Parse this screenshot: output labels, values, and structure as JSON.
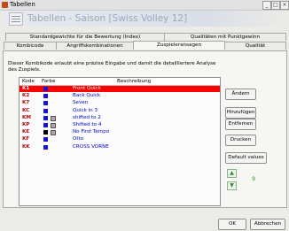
{
  "window": {
    "title": "Tabellen",
    "minimize": "_",
    "maximize": "□",
    "close": "×"
  },
  "banner": {
    "title": "Tabellen - Saison [Swiss Volley 12]"
  },
  "tabs": [
    {
      "label": "Standardgewichte für die Bewertung (Index)"
    },
    {
      "label": "Qualitäten mit Punktgewinn"
    },
    {
      "label": "Kombicode"
    },
    {
      "label": "Angriffskombinationen"
    },
    {
      "label": "Zuspieleransagen"
    },
    {
      "label": "Qualität"
    }
  ],
  "description": "Dieser Kombikode erlaubt eine präzise Eingabe und damit die detailliertere Analyse des Zuspiels.",
  "table": {
    "headers": {
      "code": "Kode",
      "color": "Farbe",
      "desc": "Beschreibung"
    },
    "rows": [
      {
        "code": "K1",
        "desc": "Front Quick",
        "color1": "#1515d6",
        "color2": ""
      },
      {
        "code": "K2",
        "desc": "Back Quick",
        "color1": "#1515d6",
        "color2": ""
      },
      {
        "code": "K7",
        "desc": "Seven",
        "color1": "#1515d6",
        "color2": ""
      },
      {
        "code": "KC",
        "desc": "Quick in 3",
        "color1": "#1515d6",
        "color2": ""
      },
      {
        "code": "KM",
        "desc": "shifted to 2",
        "color1": "#1515d6",
        "color2": "#b8a4a4"
      },
      {
        "code": "KP",
        "desc": "Shifted to 4",
        "color1": "#1515d6",
        "color2": "#b8a4a4"
      },
      {
        "code": "KE",
        "desc": "No First Tempo",
        "color1": "#000000",
        "color2": "#b8a4a4"
      },
      {
        "code": "KF",
        "desc": "Otto",
        "color1": "#1515d6",
        "color2": ""
      },
      {
        "code": "KK",
        "desc": "CROSS VORNE",
        "color1": "#1515d6",
        "color2": ""
      }
    ]
  },
  "buttons": {
    "change": "Ändern",
    "add": "Hinzufügen",
    "remove": "Entfernen",
    "print": "Drucken",
    "defaults": "Default values",
    "ok": "OK",
    "cancel": "Abbrechen"
  },
  "move": {
    "up": "▲",
    "down": "▼",
    "count": "9"
  },
  "colors": {
    "selected_row": "#ff0000",
    "code_text": "#c00000",
    "desc_text": "#0000c0",
    "accent_green": "#2f8a2f"
  }
}
